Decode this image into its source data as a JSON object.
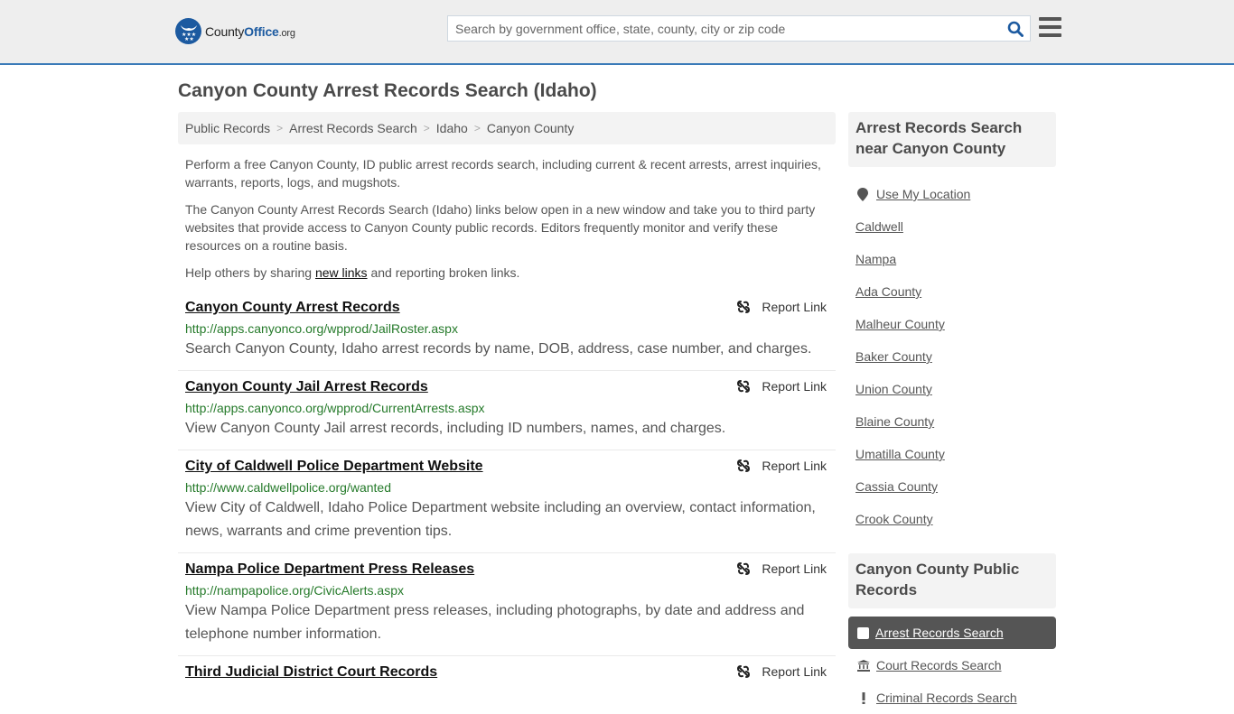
{
  "header": {
    "logo": {
      "county": "County",
      "office": "Office",
      "tld": ".org"
    },
    "search": {
      "placeholder": "Search by government office, state, county, city or zip code",
      "value": ""
    },
    "brand_color": "#1c5aa0",
    "accent_border": "#3a7ab8"
  },
  "page_title": "Canyon County Arrest Records Search (Idaho)",
  "breadcrumb": [
    {
      "label": "Public Records"
    },
    {
      "label": "Arrest Records Search"
    },
    {
      "label": "Idaho"
    },
    {
      "label": "Canyon County"
    }
  ],
  "intro": {
    "p1": "Perform a free Canyon County, ID public arrest records search, including current & recent arrests, arrest inquiries, warrants, reports, logs, and mugshots.",
    "p2": "The Canyon County Arrest Records Search (Idaho) links below open in a new window and take you to third party websites that provide access to Canyon County public records. Editors frequently monitor and verify these resources on a routine basis.",
    "p3_before": "Help others by sharing ",
    "p3_link": "new links",
    "p3_after": " and reporting broken links."
  },
  "report_label": "Report Link",
  "results": [
    {
      "title": "Canyon County Arrest Records",
      "url": "http://apps.canyonco.org/wpprod/JailRoster.aspx",
      "description": "Search Canyon County, Idaho arrest records by name, DOB, address, case number, and charges."
    },
    {
      "title": "Canyon County Jail Arrest Records",
      "url": "http://apps.canyonco.org/wpprod/CurrentArrests.aspx",
      "description": "View Canyon County Jail arrest records, including ID numbers, names, and charges."
    },
    {
      "title": "City of Caldwell Police Department Website",
      "url": "http://www.caldwellpolice.org/wanted",
      "description": "View City of Caldwell, Idaho Police Department website including an overview, contact information, news, warrants and crime prevention tips."
    },
    {
      "title": "Nampa Police Department Press Releases",
      "url": "http://nampapolice.org/CivicAlerts.aspx",
      "description": "View Nampa Police Department press releases, including photographs, by date and address and telephone number information."
    },
    {
      "title": "Third Judicial District Court Records",
      "url": "",
      "description": ""
    }
  ],
  "sidebar": {
    "nearby_heading": "Arrest Records Search near Canyon County",
    "use_location": "Use My Location",
    "nearby": [
      "Caldwell",
      "Nampa",
      "Ada County",
      "Malheur County",
      "Baker County",
      "Union County",
      "Blaine County",
      "Umatilla County",
      "Cassia County",
      "Crook County"
    ],
    "records_heading": "Canyon County Public Records",
    "records": [
      {
        "label": "Arrest Records Search",
        "icon": "checkbox-icon",
        "active": true
      },
      {
        "label": "Court Records Search",
        "icon": "courthouse-icon",
        "active": false
      },
      {
        "label": "Criminal Records Search",
        "icon": "exclamation-icon",
        "active": false
      }
    ]
  }
}
